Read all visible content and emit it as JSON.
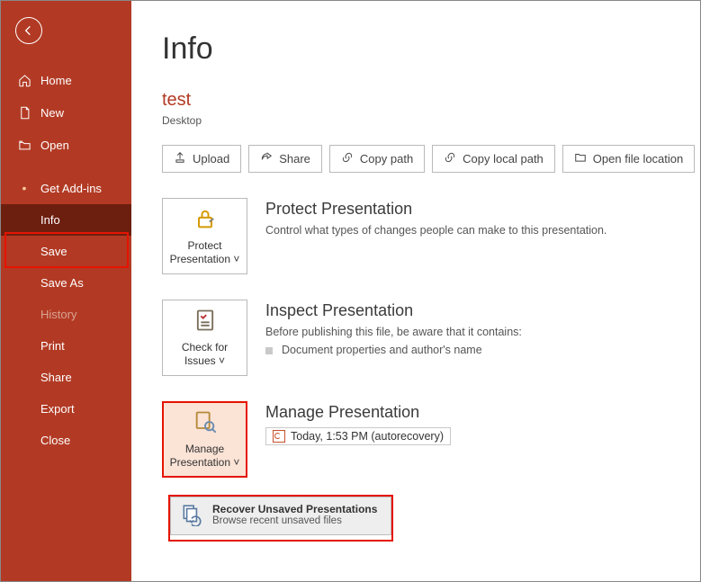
{
  "sidebar": {
    "items": [
      {
        "label": "Home"
      },
      {
        "label": "New"
      },
      {
        "label": "Open"
      },
      {
        "label": "Get Add-ins"
      },
      {
        "label": "Info"
      },
      {
        "label": "Save"
      },
      {
        "label": "Save As"
      },
      {
        "label": "History"
      },
      {
        "label": "Print"
      },
      {
        "label": "Share"
      },
      {
        "label": "Export"
      },
      {
        "label": "Close"
      }
    ]
  },
  "page": {
    "title": "Info",
    "doc_name": "test",
    "doc_loc": "Desktop"
  },
  "toolbar": {
    "upload": "Upload",
    "share": "Share",
    "copy_path": "Copy path",
    "copy_local": "Copy local path",
    "open_loc": "Open file location"
  },
  "protect": {
    "tile_line1": "Protect",
    "tile_line2": "Presentation",
    "title": "Protect Presentation",
    "desc": "Control what types of changes people can make to this presentation."
  },
  "inspect": {
    "tile_line1": "Check for",
    "tile_line2": "Issues",
    "title": "Inspect Presentation",
    "desc": "Before publishing this file, be aware that it contains:",
    "bullet": "Document properties and author's name"
  },
  "manage": {
    "tile_line1": "Manage",
    "tile_line2": "Presentation",
    "title": "Manage Presentation",
    "recovery": "Today, 1:53 PM (autorecovery)"
  },
  "popup": {
    "title": "Recover Unsaved Presentations",
    "sub": "Browse recent unsaved files"
  }
}
